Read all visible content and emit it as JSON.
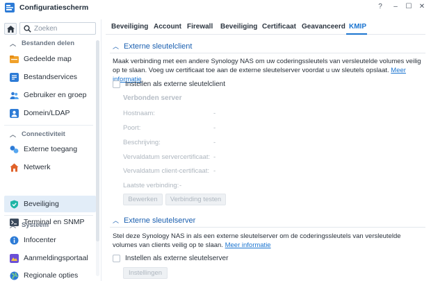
{
  "window": {
    "title": "Configuratiescherm",
    "controls": [
      "?",
      "–",
      "☐",
      "✕"
    ]
  },
  "sidebar": {
    "search_placeholder": "Zoeken",
    "sections": [
      {
        "label": "Bestanden delen",
        "items": [
          {
            "label": "Gedeelde map",
            "icon": "shared-folder-icon"
          },
          {
            "label": "Bestandservices",
            "icon": "file-services-icon"
          },
          {
            "label": "Gebruiker en groep",
            "icon": "user-group-icon"
          },
          {
            "label": "Domein/LDAP",
            "icon": "domain-ldap-icon"
          }
        ]
      },
      {
        "label": "Connectiviteit",
        "items": [
          {
            "label": "Externe toegang",
            "icon": "external-access-icon"
          },
          {
            "label": "Netwerk",
            "icon": "network-icon"
          },
          {
            "label": "Beveiliging",
            "icon": "security-shield-icon"
          },
          {
            "label": "Terminal en SNMP",
            "icon": "terminal-icon"
          }
        ]
      },
      {
        "label": "Systeem",
        "items": [
          {
            "label": "Infocenter",
            "icon": "info-center-icon"
          },
          {
            "label": "Aanmeldingsportaal",
            "icon": "login-portal-icon"
          },
          {
            "label": "Regionale opties",
            "icon": "regional-options-icon"
          }
        ]
      }
    ],
    "active_item": "Beveiliging"
  },
  "tabs": [
    "Beveiliging",
    "Account",
    "Firewall",
    "Beveiliging",
    "Certificaat",
    "Geavanceerd",
    "KMIP"
  ],
  "active_tab": "KMIP",
  "client_section": {
    "title": "Externe sleutelclient",
    "description": "Maak verbinding met een andere Synology NAS om uw coderingssleutels van versleutelde volumes veilig op te slaan. Voeg uw certificaat toe aan de externe sleutelserver voordat u uw sleutels opslaat.",
    "link": "Meer informatie",
    "checkbox_label": "Instellen als externe sleutelclient",
    "connected_heading": "Verbonden server",
    "fields": [
      {
        "label": "Hostnaam:",
        "value": "-"
      },
      {
        "label": "Poort:",
        "value": "-"
      },
      {
        "label": "Beschrijving:",
        "value": "-"
      },
      {
        "label": "Vervaldatum servercertificaat:",
        "value": "-"
      },
      {
        "label": "Vervaldatum client-certificaat:",
        "value": "-"
      },
      {
        "label": "Laatste verbinding:",
        "value": "-"
      }
    ],
    "edit_button": "Bewerken",
    "test_button": "Verbinding testen"
  },
  "server_section": {
    "title": "Externe sleutelserver",
    "description": "Stel deze Synology NAS in als een externe sleutelserver om de coderingssleutels van versleutelde volumes van clients veilig op te slaan.",
    "link": "Meer informatie",
    "checkbox_label": "Instellen als externe sleutelserver",
    "settings_button": "Instellingen"
  },
  "colors": {
    "accent": "#1a74d0",
    "section_title": "#1a5fb0",
    "active_nav_bg": "#e2edf8",
    "disabled_text": "#aeb6bf"
  }
}
